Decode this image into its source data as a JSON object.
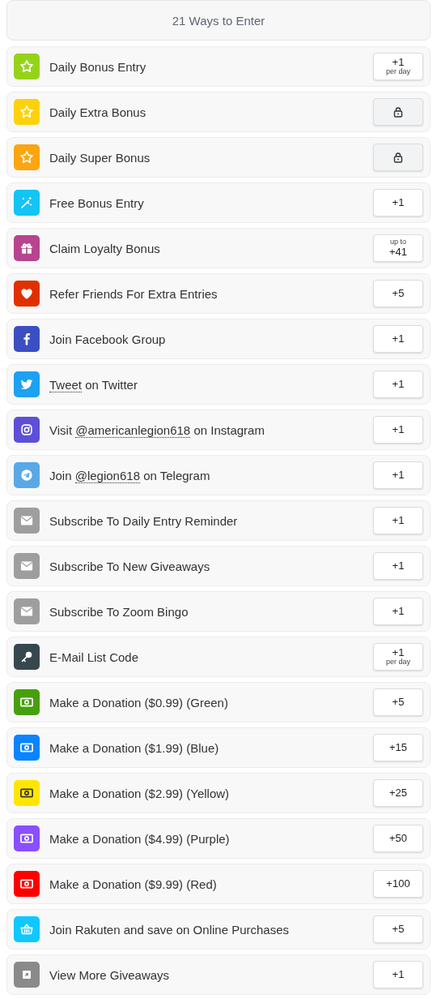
{
  "header": {
    "title": "21 Ways to Enter"
  },
  "entries": [
    {
      "kind": "daily",
      "color": "#95d31a",
      "label": [
        {
          "text": "Daily Bonus Entry"
        }
      ],
      "badge": {
        "kind": "points",
        "value": "+1",
        "note": "per day"
      }
    },
    {
      "kind": "daily",
      "color": "#fdd10b",
      "label": [
        {
          "text": "Daily Extra Bonus"
        }
      ],
      "badge": {
        "kind": "locked"
      }
    },
    {
      "kind": "daily",
      "color": "#fba511",
      "label": [
        {
          "text": "Daily Super Bonus"
        }
      ],
      "badge": {
        "kind": "locked"
      }
    },
    {
      "kind": "bonus",
      "color": "#13c4f4",
      "label": [
        {
          "text": "Free Bonus Entry"
        }
      ],
      "badge": {
        "kind": "points",
        "value": "+1"
      }
    },
    {
      "kind": "loyalty",
      "color": "#b8438f",
      "label": [
        {
          "text": "Claim Loyalty Bonus"
        }
      ],
      "badge": {
        "kind": "points",
        "prefix": "up to",
        "value": "+41"
      }
    },
    {
      "kind": "refer",
      "color": "#e13000",
      "label": [
        {
          "text": "Refer Friends For Extra Entries"
        }
      ],
      "badge": {
        "kind": "points",
        "value": "+5"
      }
    },
    {
      "kind": "facebook",
      "color": "#3b4fc2",
      "label": [
        {
          "text": "Join Facebook Group"
        }
      ],
      "badge": {
        "kind": "points",
        "value": "+1"
      }
    },
    {
      "kind": "twitter",
      "color": "#1da1f2",
      "label": [
        {
          "text": "Tweet",
          "link": true
        },
        {
          "text": " on Twitter"
        }
      ],
      "badge": {
        "kind": "points",
        "value": "+1"
      }
    },
    {
      "kind": "instagram",
      "color": "#5d4fd8",
      "label": [
        {
          "text": "Visit "
        },
        {
          "text": "@americanlegion618",
          "link": true
        },
        {
          "text": " on Instagram"
        }
      ],
      "badge": {
        "kind": "points",
        "value": "+1"
      }
    },
    {
      "kind": "telegram",
      "color": "#5aa8e6",
      "label": [
        {
          "text": "Join "
        },
        {
          "text": "@legion618",
          "link": true
        },
        {
          "text": " on Telegram"
        }
      ],
      "badge": {
        "kind": "points",
        "value": "+1"
      }
    },
    {
      "kind": "subscribe",
      "color": "#9e9e9e",
      "label": [
        {
          "text": "Subscribe To Daily Entry Reminder"
        }
      ],
      "badge": {
        "kind": "points",
        "value": "+1"
      }
    },
    {
      "kind": "subscribe",
      "color": "#9e9e9e",
      "label": [
        {
          "text": "Subscribe To New Giveaways"
        }
      ],
      "badge": {
        "kind": "points",
        "value": "+1"
      }
    },
    {
      "kind": "subscribe",
      "color": "#9e9e9e",
      "label": [
        {
          "text": "Subscribe To Zoom Bingo"
        }
      ],
      "badge": {
        "kind": "points",
        "value": "+1"
      }
    },
    {
      "kind": "code",
      "color": "#37474f",
      "label": [
        {
          "text": "E-Mail List Code"
        }
      ],
      "badge": {
        "kind": "points",
        "value": "+1",
        "note": "per day"
      }
    },
    {
      "kind": "donation",
      "color": "#46a00c",
      "label": [
        {
          "text": "Make a Donation ($0.99) (Green)"
        }
      ],
      "badge": {
        "kind": "points",
        "value": "+5"
      }
    },
    {
      "kind": "donation",
      "color": "#0a84ff",
      "label": [
        {
          "text": "Make a Donation ($1.99) (Blue)"
        }
      ],
      "badge": {
        "kind": "points",
        "value": "+15"
      }
    },
    {
      "kind": "donation",
      "color": "#ffe600",
      "label": [
        {
          "text": "Make a Donation ($2.99) (Yellow)"
        }
      ],
      "badge": {
        "kind": "points",
        "value": "+25"
      }
    },
    {
      "kind": "donation",
      "color": "#8a4fff",
      "label": [
        {
          "text": "Make a Donation ($4.99) (Purple)"
        }
      ],
      "badge": {
        "kind": "points",
        "value": "+50"
      }
    },
    {
      "kind": "donation",
      "color": "#ff0000",
      "label": [
        {
          "text": "Make a Donation ($9.99) (Red)"
        }
      ],
      "badge": {
        "kind": "points",
        "value": "+100"
      }
    },
    {
      "kind": "rakuten",
      "color": "#0ec8ff",
      "label": [
        {
          "text": "Join Rakuten and save on Online Purchases"
        }
      ],
      "badge": {
        "kind": "points",
        "value": "+5"
      }
    },
    {
      "kind": "more",
      "color": "#8a8a8a",
      "label": [
        {
          "text": "View More Giveaways"
        }
      ],
      "badge": {
        "kind": "points",
        "value": "+1"
      }
    }
  ]
}
